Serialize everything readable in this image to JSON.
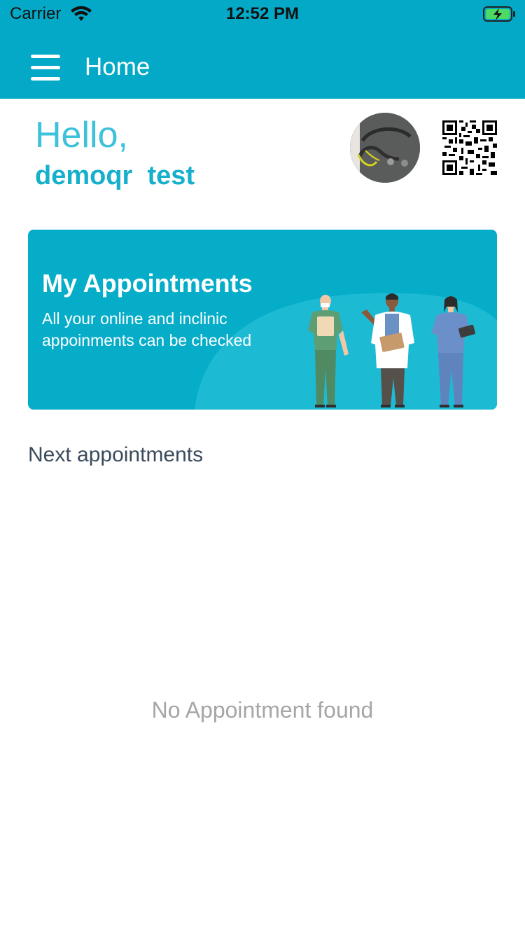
{
  "status_bar": {
    "carrier": "Carrier",
    "time": "12:52 PM",
    "icons": [
      "wifi-icon",
      "battery-charging-icon"
    ]
  },
  "nav": {
    "menu_icon": "hamburger-menu-icon",
    "title": "Home"
  },
  "greeting": {
    "hello": "Hello,",
    "username": "demoqr  test"
  },
  "header_icons": [
    "avatar",
    "qr-code-icon"
  ],
  "banner": {
    "title": "My Appointments",
    "description": "All your online and inclinic appoinments can be checked",
    "illustration": "medical-staff-illustration"
  },
  "appointments": {
    "section_title": "Next appointments",
    "empty_message": "No Appointment found"
  },
  "colors": {
    "primary": "#03a9c7",
    "greeting": "#3ec1da",
    "section_text": "#3b4b5c",
    "muted": "#a6a6a6"
  }
}
